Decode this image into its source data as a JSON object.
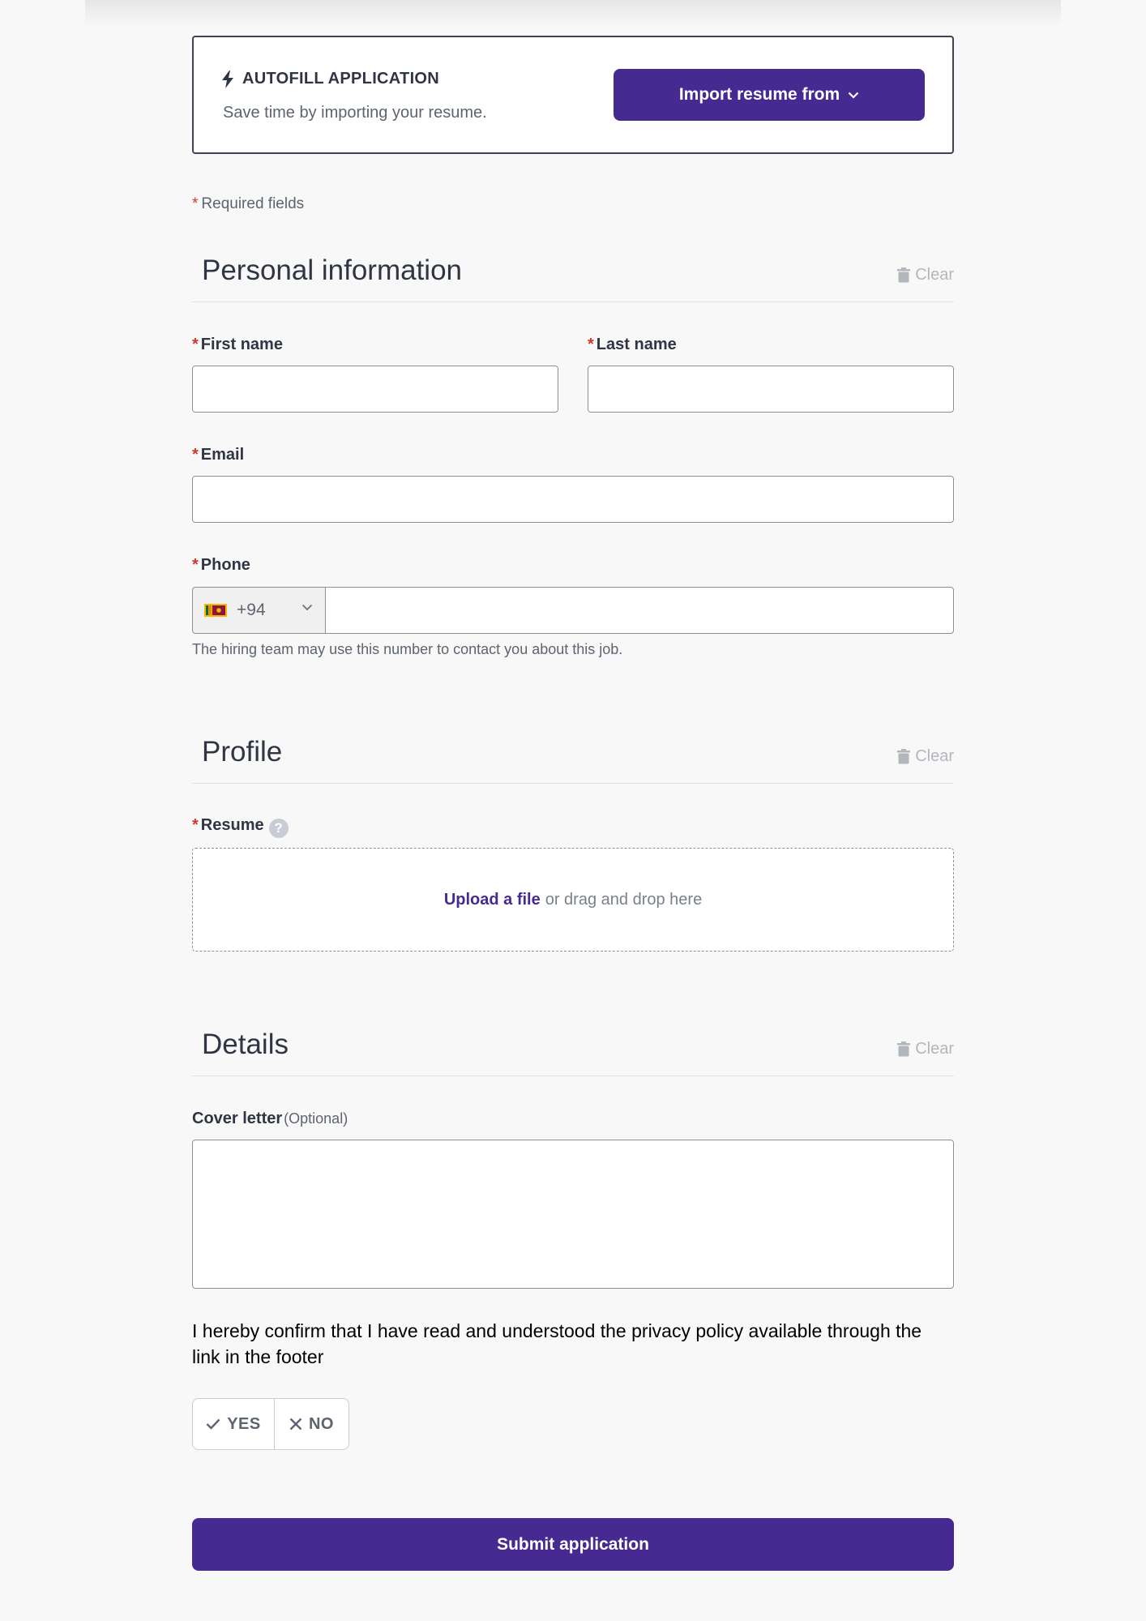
{
  "autofill": {
    "title": "AUTOFILL APPLICATION",
    "subtitle": "Save time by importing your resume.",
    "import_label": "Import resume from"
  },
  "required_note": "Required fields",
  "sections": {
    "personal": {
      "title": "Personal information",
      "clear_label": "Clear"
    },
    "profile": {
      "title": "Profile",
      "clear_label": "Clear"
    },
    "details": {
      "title": "Details",
      "clear_label": "Clear"
    }
  },
  "fields": {
    "first_name": {
      "label": "First name",
      "value": ""
    },
    "last_name": {
      "label": "Last name",
      "value": ""
    },
    "email": {
      "label": "Email",
      "value": ""
    },
    "phone": {
      "label": "Phone",
      "country_code": "+94",
      "value": "",
      "hint": "The hiring team may use this number to contact you about this job."
    },
    "resume": {
      "label": "Resume",
      "help": "?",
      "upload_link": "Upload a file",
      "drop_text": "or drag and drop here"
    },
    "cover_letter": {
      "label": "Cover letter",
      "optional": "(Optional)",
      "value": ""
    }
  },
  "consent": {
    "text": "I hereby confirm that I have read and understood the privacy policy available through the link in the footer",
    "yes_label": "YES",
    "no_label": "NO"
  },
  "submit_label": "Submit application",
  "colors": {
    "accent": "#472a91",
    "required": "#d0382b"
  },
  "icons": [
    "bolt-icon",
    "chevron-down-icon",
    "trash-icon",
    "help-icon",
    "sri-lanka-flag-icon",
    "check-icon",
    "x-icon"
  ]
}
